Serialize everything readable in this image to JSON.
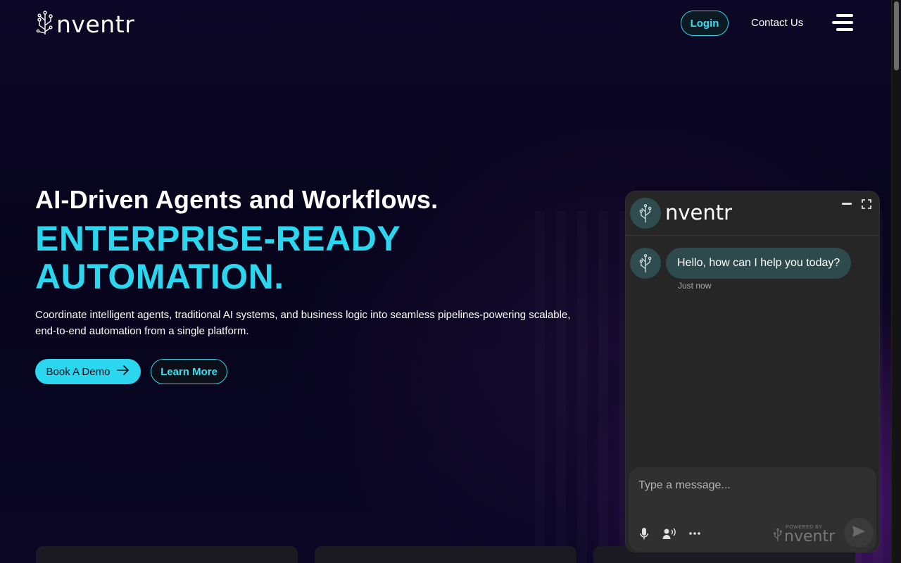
{
  "header": {
    "brand": "nventr",
    "login_label": "Login",
    "contact_label": "Contact Us"
  },
  "hero": {
    "headline": "AI-Driven Agents and Workflows.",
    "tagline_line1": "ENTERPRISE-READY",
    "tagline_line2": "AUTOMATION.",
    "description": "Coordinate intelligent agents, traditional AI systems, and business logic into seamless pipelines-powering scalable, end-to-end automation from a single platform.",
    "cta_primary": "Book A Demo",
    "cta_secondary": "Learn More"
  },
  "chat": {
    "brand": "nventr",
    "messages": [
      {
        "sender": "bot",
        "text": "Hello, how can I help you today?",
        "time": "Just now"
      }
    ],
    "input_placeholder": "Type a message...",
    "powered_by_label": "POWERED BY",
    "powered_by_brand": "nventr"
  },
  "colors": {
    "accent": "#2ad7ee",
    "background": "#080521",
    "chat_panel": "#262626",
    "bubble": "#2e4a4c"
  },
  "icons": {
    "logo": "circuit-tree-icon",
    "menu": "hamburger-menu-icon",
    "arrow": "arrow-right-icon",
    "minimize": "minimize-icon",
    "expand": "expand-icon",
    "mic": "microphone-icon",
    "voice": "voice-mode-icon",
    "more": "more-dots-icon",
    "send": "send-icon"
  }
}
